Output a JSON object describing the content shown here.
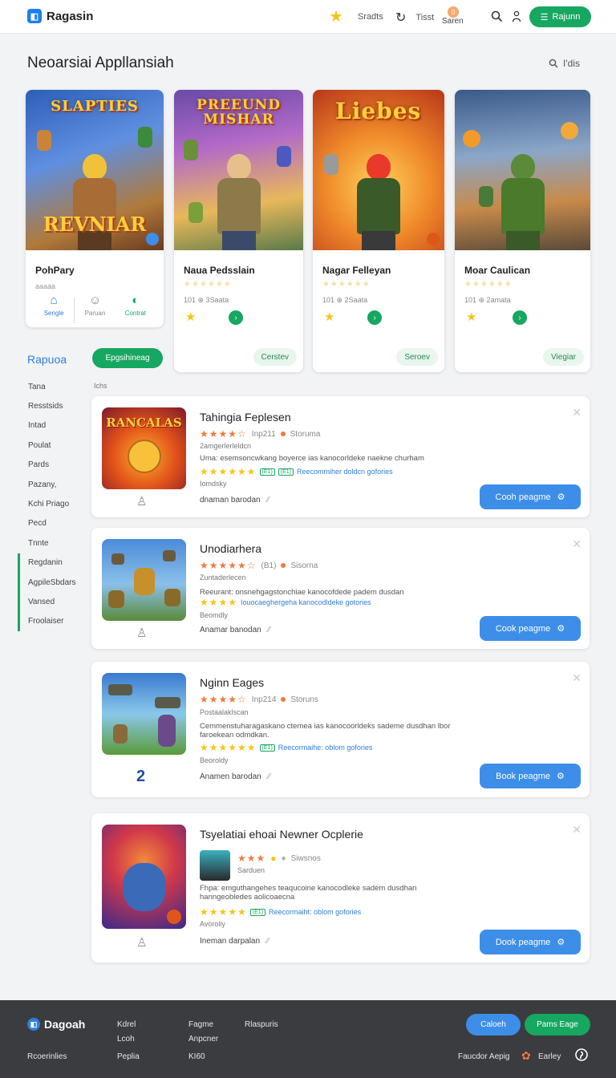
{
  "header": {
    "logo": "Ragasin",
    "nav": [
      {
        "label": "Sradts",
        "icon": "star-icon"
      },
      {
        "label": "Tisst",
        "icon": "refresh-icon"
      }
    ],
    "notif_badge": "0",
    "notif_label": "Saren",
    "cta": "Rajunn"
  },
  "title": "Neoarsiai Appllansiah",
  "filter": "I'dis",
  "featured": [
    {
      "art_title": "SLAPTIES",
      "art_sub": "REVNIAR",
      "name": "PohPary",
      "sub": "aaaaa",
      "nav": [
        {
          "label": "Sengle",
          "icon": "home-icon",
          "color": "#2f7fd8"
        },
        {
          "label": "Paruan",
          "icon": "smile-icon",
          "color": "#888888"
        },
        {
          "label": "Contrat",
          "icon": "contrast-icon",
          "color": "#16a760"
        }
      ]
    },
    {
      "art_title": "PREEUND MISHAR",
      "name": "Naua Pedsslain",
      "stars": "★★★★★★",
      "meta": "101 ⊕   3Saata",
      "pill": "Cerstev"
    },
    {
      "art_title": "Liebes",
      "name": "Nagar Felleyan",
      "stars": "★★★★★★",
      "meta": "101 ⊕   2Saata",
      "pill": "Seroev"
    },
    {
      "art_title": "",
      "name": "Moar Caulican",
      "stars": "★★★★★★",
      "meta": "101 ⊕   2amata",
      "pill": "Viegiar"
    }
  ],
  "sidebar": {
    "title": "Rapuoa",
    "button": "Epgsihineag",
    "list_label": "Ichs",
    "items": [
      "Tana",
      "Resstsids",
      "Intad",
      "Poulat",
      "Pards",
      "Pazany,",
      "Kchi Priago",
      "Pecd",
      "Tnnte",
      "Regdanin",
      "AgpileSbdars",
      "Vansed",
      "Froolaiser"
    ]
  },
  "rows": [
    {
      "title": "Tahingia Feplesen",
      "rating_num": "Inp211",
      "rating_tag": "Storuma",
      "line1": "2amgerlerleldcn",
      "desc": "Uma: esemsoncwkang boyerce ias kanocorldeke naekne churham",
      "tag": "Reecommiher doldcn gofories",
      "line2": "Iomdsky",
      "author": "dnaman barodan",
      "button": "Cooh peagme"
    },
    {
      "title": "Unodiarhera",
      "rating_num": "(B1)",
      "rating_tag": "Sisorna",
      "line1": "Zuntaderlecen",
      "desc": "Reeurant: onsnehgagstonchiae kanocofdede padem dusdan",
      "tag": "Iouocaeghergeha kanocodldeke gotories",
      "line2": "Beomdly",
      "author": "Anamar banodan",
      "button": "Cook peagme"
    },
    {
      "title": "Nginn Eages",
      "rating_num": "Inp214",
      "rating_tag": "Storuns",
      "line1": "Postaalaklscan",
      "desc": "Cemmenstuharagaskano ctemea ias kanocoorldeks sademe dusdhan lbor faroekean odmdkan.",
      "tag": "Reecormaihe: oblom gofories",
      "line2": "Beoroldy",
      "author": "Anamen barodan",
      "button": "Book peagme"
    },
    {
      "title": "Tsyelatiai ehoai Newner Ocplerie",
      "rating_num": "",
      "rating_tag": "Siwsnos",
      "line1": "Sarduen",
      "desc": "Fhpa: emguthangehes teaqucoine kanocodleke sadem dusdhan hanngeobledes aolicoaecna",
      "tag": "Reecormaiht: oblom gofories",
      "line2": "Avoroliy",
      "author": "Ineman darpalan",
      "button": "Dook peagme"
    }
  ],
  "footer": {
    "logo": "Dagoah",
    "links": [
      "Kdrel",
      "Lcoh",
      "Fagme",
      "Anpcner",
      "Rlaspuris",
      "Rcoerinlies",
      "Peplia",
      "KI60"
    ],
    "btn_primary": "Caloeh",
    "btn_secondary": "Pams Eage",
    "tagline": "Faucdor Aepig",
    "social_label": "Earley"
  },
  "colors": {
    "accent_green": "#16a760",
    "accent_blue": "#3d8ee8",
    "footer_bg": "#3a3c40"
  }
}
